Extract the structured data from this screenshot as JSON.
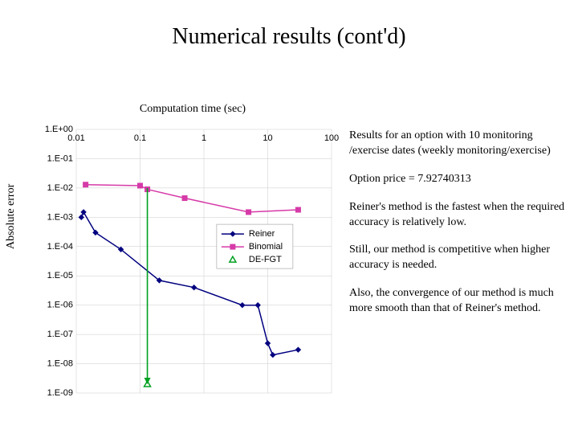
{
  "title": "Numerical results (cont'd)",
  "xlabel": "Computation time (sec)",
  "ylabel": "Absolute error",
  "notes": {
    "p1": "Results for an option with 10 monitoring /exercise dates\n(weekly monitoring/exercise)",
    "p2": "Option price = 7.92740313",
    "p3": "Reiner's method is the fastest when the required accuracy is relatively low.",
    "p4": "Still, our method is competitive when higher accuracy is needed.",
    "p5": "Also, the convergence of our method is much more smooth than that of Reiner's method."
  },
  "legend": {
    "reiner": "Reiner",
    "binomial": "Binomial",
    "defgt": "DE-FGT"
  },
  "chart_data": {
    "type": "line",
    "xscale": "log",
    "yscale": "log",
    "xlabel": "Computation time (sec)",
    "ylabel": "Absolute error",
    "xlim": [
      0.01,
      100
    ],
    "ylim": [
      1e-09,
      1.0
    ],
    "xticks": [
      0.01,
      0.1,
      1,
      10,
      100
    ],
    "yticks": [
      1e-09,
      1e-08,
      1e-07,
      1e-06,
      1e-05,
      0.0001,
      0.001,
      0.01,
      0.1,
      1.0
    ],
    "ytick_labels": [
      "1.E-09",
      "1.E-08",
      "1.E-07",
      "1.E-06",
      "1.E-05",
      "1.E-04",
      "1.E-03",
      "1.E-02",
      "1.E-01",
      "1.E+00"
    ],
    "grid": true,
    "legend_position": "inside-right-upper",
    "series": [
      {
        "name": "Reiner",
        "marker": "diamond",
        "color": "#00007f",
        "x": [
          0.012,
          0.013,
          0.02,
          0.05,
          0.2,
          0.7,
          4.0,
          7.0,
          10.0,
          12.0,
          30.0
        ],
        "y": [
          0.001,
          0.0015,
          0.0003,
          8e-05,
          7e-06,
          4e-06,
          1e-06,
          1e-06,
          5e-08,
          2e-08,
          3e-08
        ]
      },
      {
        "name": "Binomial",
        "marker": "square",
        "color": "#d63aa8",
        "x": [
          0.014,
          0.1,
          0.13,
          0.5,
          5.0,
          30.0
        ],
        "y": [
          0.013,
          0.012,
          0.009,
          0.0045,
          0.0015,
          0.0018
        ]
      },
      {
        "name": "DE-FGT",
        "marker": "triangle",
        "color": "#00a020",
        "x": [
          0.13
        ],
        "y": [
          2e-09
        ]
      }
    ]
  }
}
